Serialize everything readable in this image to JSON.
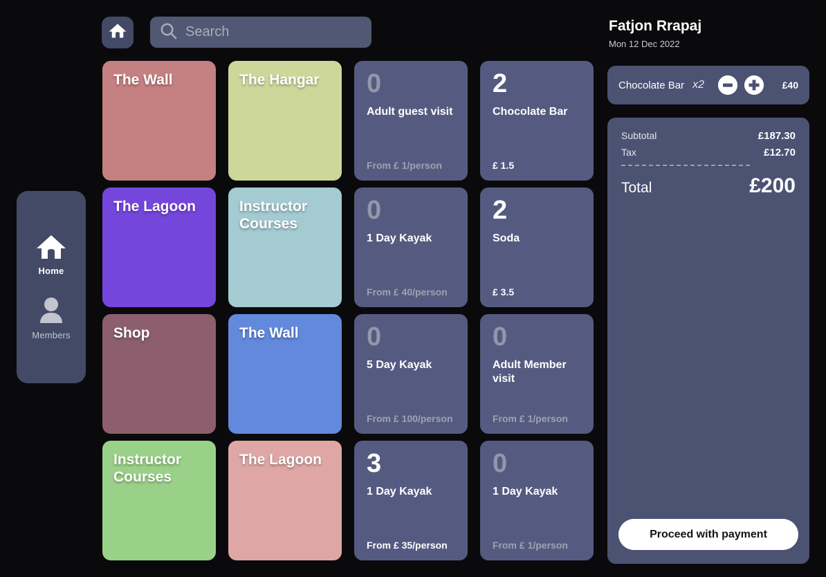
{
  "topbar": {
    "home_icon": "home-icon",
    "search": {
      "placeholder": "Search",
      "value": "",
      "icon": "search-icon"
    }
  },
  "sidebar": {
    "items": [
      {
        "label": "Home",
        "icon": "home-icon",
        "active": true
      },
      {
        "label": "Members",
        "icon": "person-icon",
        "active": false
      }
    ]
  },
  "grid": {
    "tiles": [
      {
        "kind": "category",
        "name": "The Wall",
        "color": "#c58081"
      },
      {
        "kind": "category",
        "name": "The Hangar",
        "color": "#cdd79a"
      },
      {
        "kind": "product",
        "name": "Adult guest visit",
        "qty": "0",
        "price": "From  £ 1/person",
        "active": false
      },
      {
        "kind": "product",
        "name": "Chocolate Bar",
        "qty": "2",
        "price": "£ 1.5",
        "active": true
      },
      {
        "kind": "category",
        "name": "The Lagoon",
        "color": "#7546dc"
      },
      {
        "kind": "category",
        "name": "Instructor Courses",
        "color": "#a3cbd1"
      },
      {
        "kind": "product",
        "name": "1 Day Kayak",
        "qty": "0",
        "price": "From  £ 40/person",
        "active": false
      },
      {
        "kind": "product",
        "name": "Soda",
        "qty": "2",
        "price": "£ 3.5",
        "active": true
      },
      {
        "kind": "category",
        "name": "Shop",
        "color": "#8d5f6e"
      },
      {
        "kind": "category",
        "name": "The Wall",
        "color": "#6289dc"
      },
      {
        "kind": "product",
        "name": "5 Day Kayak",
        "qty": "0",
        "price": "From  £ 100/person",
        "active": false
      },
      {
        "kind": "product",
        "name": "Adult Member visit",
        "qty": "0",
        "price": "From  £ 1/person",
        "active": false
      },
      {
        "kind": "category",
        "name": "Instructor Courses",
        "color": "#9ad189"
      },
      {
        "kind": "category",
        "name": "The Lagoon",
        "color": "#dfa6a6"
      },
      {
        "kind": "product",
        "name": "1 Day Kayak",
        "qty": "3",
        "price": "From  £ 35/person",
        "active": true
      },
      {
        "kind": "product",
        "name": "1 Day Kayak",
        "qty": "0",
        "price": "From  £ 1/person",
        "active": false
      }
    ]
  },
  "order": {
    "customer_name": "Fatjon Rrapaj",
    "date": "Mon 12 Dec 2022",
    "line_item": {
      "name": "Chocolate Bar",
      "multiplier": "x2",
      "price": "£40",
      "minus_icon": "minus-circle-icon",
      "plus_icon": "plus-circle-icon"
    },
    "totals": {
      "subtotal_label": "Subtotal",
      "subtotal_value": "£187.30",
      "tax_label": "Tax",
      "tax_value": "£12.70",
      "total_label": "Total",
      "total_value": "£200"
    },
    "pay_label": "Proceed with payment"
  },
  "colors": {
    "page_background": "#0a0a0c",
    "panel": "#4b5272",
    "rail": "#434a66",
    "product_tile": "#555b80",
    "search_field": "#515873",
    "accent_white": "#ffffff"
  }
}
